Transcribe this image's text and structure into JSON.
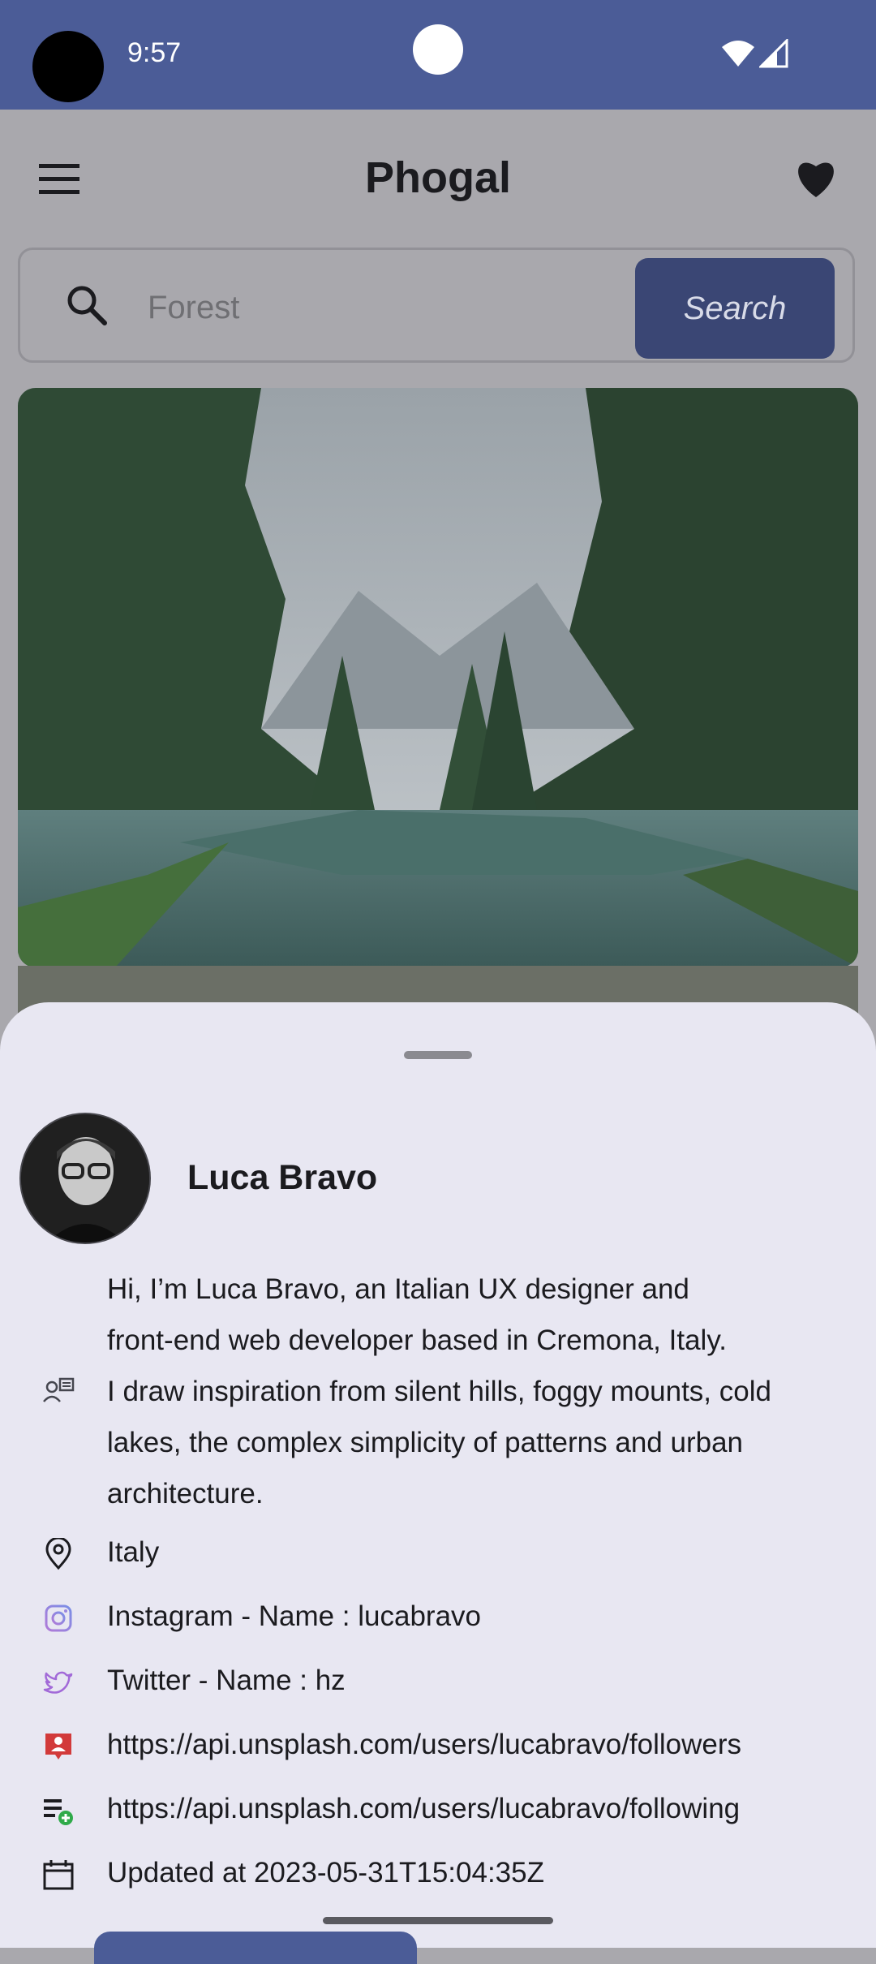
{
  "status_bar": {
    "time": "9:57",
    "bg_color": "#4b5c97"
  },
  "app_bar": {
    "title": "Phogal",
    "menu_icon": "menu-icon",
    "favorite_icon": "heart-icon"
  },
  "search": {
    "value": "Forest",
    "placeholder": "Forest",
    "button_label": "Search",
    "button_color": "#3a4674"
  },
  "photo": {
    "description_icon": "forest-lake-photo"
  },
  "sheet": {
    "user_name": "Luca Bravo",
    "bio": "Hi, I’m Luca Bravo, an Italian UX designer and\nfront-end web developer based in Cremona, Italy.\nI draw inspiration from silent hills, foggy mounts, cold\nlakes, the complex simplicity of patterns and urban\narchitecture.",
    "location": "Italy",
    "instagram": "Instagram - Name : lucabravo",
    "twitter": "Twitter - Name : hz",
    "followers": "https://api.unsplash.com/users/lucabravo/followers",
    "following": "https://api.unsplash.com/users/lucabravo/following",
    "updated": "Updated at 2023-05-31T15:04:35Z",
    "accent_red": "#d23a3a",
    "bg_color": "#e8e7f2"
  }
}
